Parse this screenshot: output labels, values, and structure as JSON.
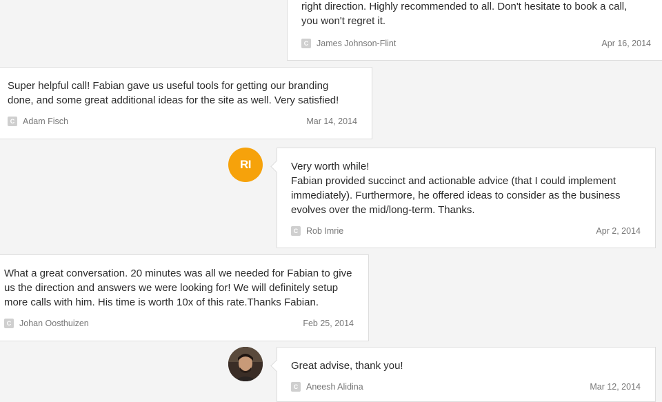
{
  "reviews": [
    {
      "text": "right direction. Highly recommended to all. Don't hesitate to book a call,\nyou won't regret it.",
      "author": "James Johnson-Flint",
      "date": "Apr 16, 2014",
      "source_icon": "C"
    },
    {
      "text": "Super helpful call! Fabian gave us useful tools for getting our branding\ndone, and some great additional ideas for the site as well. Very satisfied!",
      "author": "Adam Fisch",
      "date": "Mar 14, 2014",
      "source_icon": "C"
    },
    {
      "avatar_initials": "RI",
      "avatar_color": "#f6a20b",
      "text": "Very worth while!\nFabian provided succinct and actionable advice (that I could implement\nimmediately). Furthermore, he offered ideas to consider as the business\nevolves over the mid/long-term. Thanks.",
      "author": "Rob Imrie",
      "date": "Apr 2, 2014",
      "source_icon": "C"
    },
    {
      "text": "What a great conversation. 20 minutes was all we needed for Fabian to give\nus the direction and answers we were looking for! We will definitely setup\nmore calls with him. His time is worth 10x of this rate.Thanks Fabian.",
      "author": "Johan Oosthuizen",
      "date": "Feb 25, 2014",
      "source_icon": "C"
    },
    {
      "text": "Great advise, thank you!",
      "author": "Aneesh Alidina",
      "date": "Mar 12, 2014",
      "source_icon": "C"
    }
  ]
}
